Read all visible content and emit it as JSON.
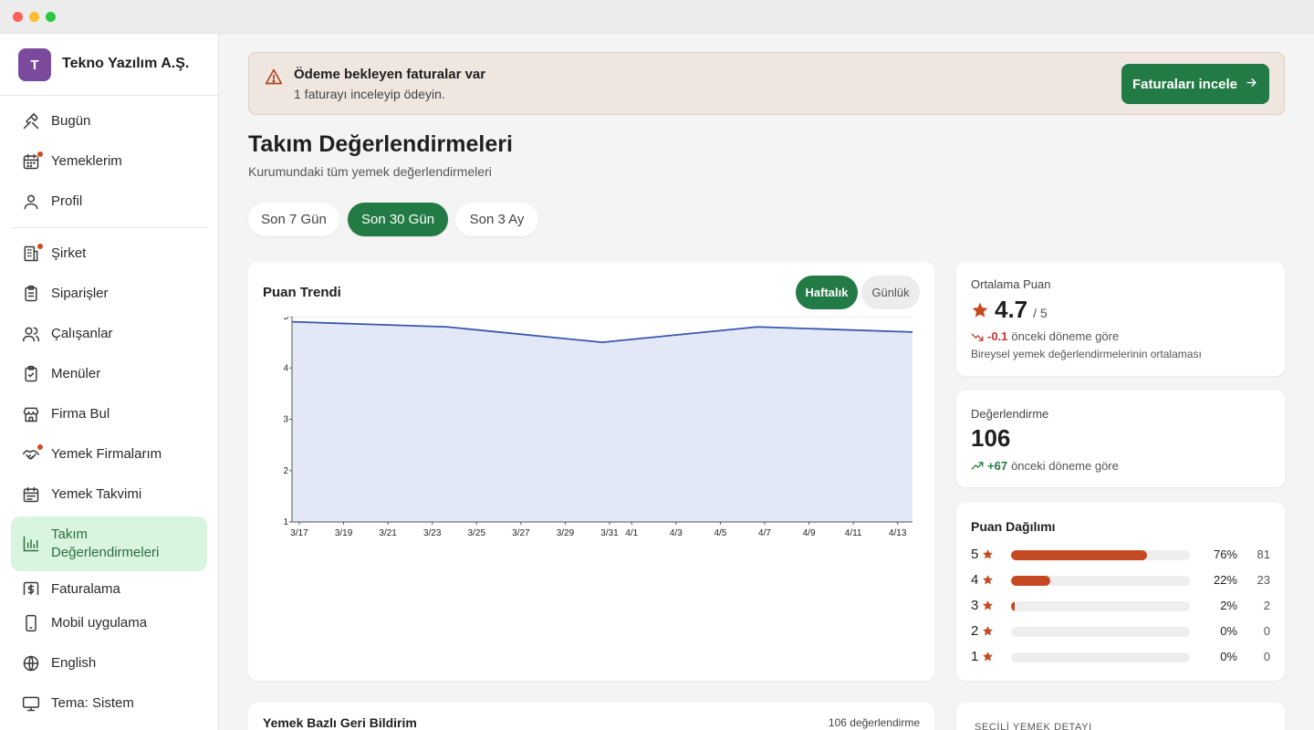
{
  "sidebar": {
    "company_initial": "T",
    "company_name": "Tekno Yazılım A.Ş.",
    "items": [
      {
        "label": "Bugün",
        "icon": "utensils-crossed-icon"
      },
      {
        "label": "Yemeklerim",
        "icon": "calendar-icon",
        "badge": true
      },
      {
        "label": "Profil",
        "icon": "user-icon"
      },
      {
        "label": "Şirket",
        "icon": "building-icon",
        "badge": true
      },
      {
        "label": "Siparişler",
        "icon": "clipboard-list-icon"
      },
      {
        "label": "Çalışanlar",
        "icon": "users-icon"
      },
      {
        "label": "Menüler",
        "icon": "clipboard-check-icon"
      },
      {
        "label": "Firma Bul",
        "icon": "store-icon"
      },
      {
        "label": "Yemek Firmalarım",
        "icon": "handshake-icon",
        "badge": true
      },
      {
        "label": "Yemek Takvimi",
        "icon": "calendar-days-icon"
      },
      {
        "label": "Takım Değerlendirmeleri",
        "icon": "bar-chart-icon",
        "active": true
      },
      {
        "label": "Faturalama",
        "icon": "receipt-icon"
      }
    ],
    "footer": [
      {
        "label": "Mobil uygulama",
        "icon": "smartphone-icon"
      },
      {
        "label": "English",
        "icon": "globe-icon"
      },
      {
        "label": "Tema: Sistem",
        "icon": "monitor-icon"
      }
    ]
  },
  "alert": {
    "title": "Ödeme bekleyen faturalar var",
    "subtitle": "1 faturayı inceleyip ödeyin.",
    "button": "Faturaları incele",
    "button_icon": "arrow-right-icon",
    "icon": "warning-triangle-icon"
  },
  "page": {
    "title": "Takım Değerlendirmeleri",
    "subtitle": "Kurumundaki tüm yemek değerlendirmeleri"
  },
  "ranges": [
    {
      "label": "Son 7 Gün",
      "active": false
    },
    {
      "label": "Son 30 Gün",
      "active": true
    },
    {
      "label": "Son 3 Ay",
      "active": false
    }
  ],
  "trend": {
    "title": "Puan Trendi",
    "toggle_weekly": "Haftalık",
    "toggle_daily": "Günlük"
  },
  "chart_data": {
    "type": "area",
    "title": "Puan Trendi",
    "x": [
      "3/17",
      "3/24",
      "3/31",
      "4/7",
      "4/14"
    ],
    "values": [
      4.9,
      4.8,
      4.5,
      4.8,
      4.7
    ],
    "x_ticks": [
      "3/17",
      "3/19",
      "3/21",
      "3/23",
      "3/25",
      "3/27",
      "3/29",
      "3/31",
      "4/1",
      "4/3",
      "4/5",
      "4/7",
      "4/9",
      "4/11",
      "4/13"
    ],
    "y_ticks": [
      "5",
      "4",
      "3",
      "2",
      "1"
    ],
    "ylim": [
      1,
      5
    ],
    "grid": true,
    "line_color": "#3a56b0",
    "fill_color": "#e2e8f5"
  },
  "avg": {
    "label": "Ortalama Puan",
    "value": "4.7",
    "out_of": "/ 5",
    "delta": "-0.1",
    "delta_note": "önceki döneme göre",
    "desc": "Bireysel yemek değerlendirmelerinin ortalaması"
  },
  "count": {
    "label": "Değerlendirme",
    "value": "106",
    "delta": "+67",
    "delta_note": "önceki döneme göre"
  },
  "distribution": {
    "title": "Puan Dağılımı",
    "rows": [
      {
        "star": "5",
        "pct": "76%",
        "count": "81",
        "fill": 0.76
      },
      {
        "star": "4",
        "pct": "22%",
        "count": "23",
        "fill": 0.22
      },
      {
        "star": "3",
        "pct": "2%",
        "count": "2",
        "fill": 0.02
      },
      {
        "star": "2",
        "pct": "0%",
        "count": "0",
        "fill": 0
      },
      {
        "star": "1",
        "pct": "0%",
        "count": "0",
        "fill": 0
      }
    ]
  },
  "feedback": {
    "title": "Yemek Bazlı Geri Bildirim",
    "count": "106 değerlendirme"
  },
  "detail": {
    "title": "SEÇİLİ YEMEK DETAYI"
  },
  "colors": {
    "accent": "#227a45",
    "bar": "#c54a22",
    "negative": "#c0392b",
    "positive": "#227a45"
  }
}
